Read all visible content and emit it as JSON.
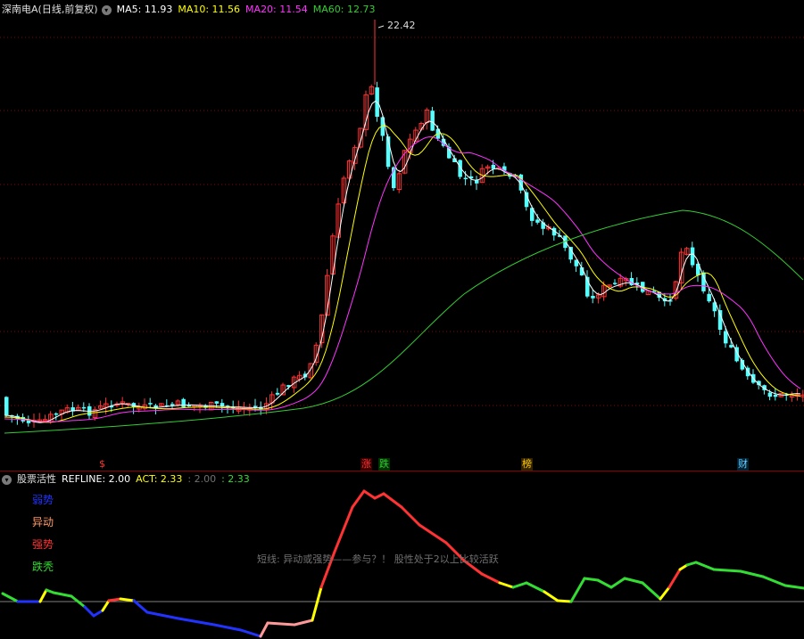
{
  "main": {
    "stock_title": "深南电A(日线,前复权)",
    "ma": [
      {
        "label": "MA5: 11.93",
        "color": "#ffffff"
      },
      {
        "label": "MA10: 11.56",
        "color": "#ffff00"
      },
      {
        "label": "MA20: 11.54",
        "color": "#ff33ff"
      },
      {
        "label": "MA60: 12.73",
        "color": "#33cc33"
      }
    ],
    "peak_label": "22.42",
    "events": [
      {
        "text": "$",
        "color": "#ff3333"
      },
      {
        "text": "涨",
        "color": "#ff3333"
      },
      {
        "text": "跌",
        "color": "#33cc33"
      },
      {
        "text": "榜",
        "color": "#ffcc00"
      },
      {
        "text": "财",
        "color": "#66ccff"
      }
    ]
  },
  "sub": {
    "indicator_title": "股票活性",
    "refline": "REFLINE: 2.00",
    "act": "ACT: 2.33",
    "val1": ": 2.00",
    "val2": ": 2.33",
    "levels": [
      {
        "label": "弱势",
        "color": "#2233ff"
      },
      {
        "label": "异动",
        "color": "#ff9966"
      },
      {
        "label": "强势",
        "color": "#ff3333"
      },
      {
        "label": "跌秃",
        "color": "#33dd33"
      }
    ],
    "note": "短线: 异动或强势——参与？！ 股性处于2以上比较活跃"
  },
  "colors": {
    "up": "#ff3333",
    "down": "#54ffff",
    "grid": "#8a0000",
    "ma5": "#ffffff",
    "ma10": "#ffff00",
    "ma20": "#ff33ff",
    "ma60": "#33cc33"
  },
  "chart_data": {
    "type": "candlestick",
    "price_peak": 22.42,
    "ma_last": {
      "MA5": 11.93,
      "MA10": 11.56,
      "MA20": 11.54,
      "MA60": 12.73
    },
    "refline": 2.0,
    "act": 2.33
  }
}
